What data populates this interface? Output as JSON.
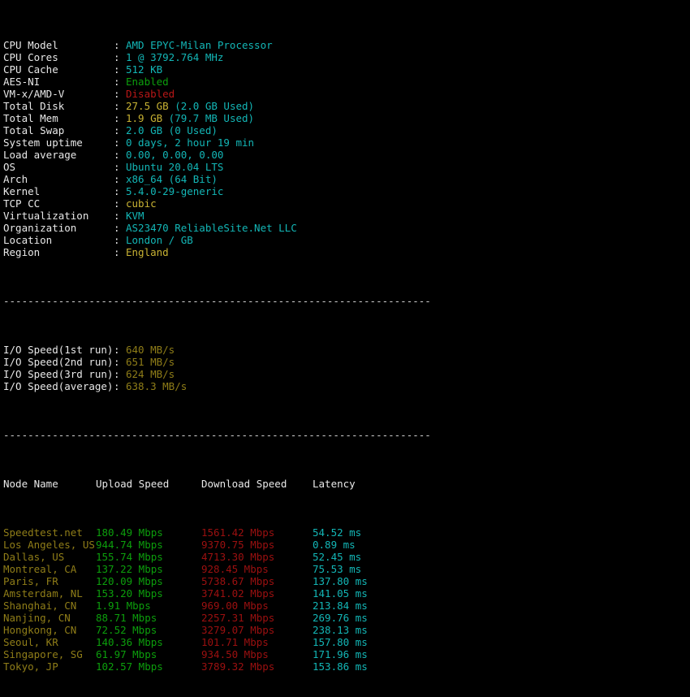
{
  "terminal": {
    "background": "#000000",
    "foreground": "#e8e8e8",
    "colors": {
      "cyan": "#13b6b6",
      "green": "#0c9e0c",
      "red": "#b81717",
      "dark_red": "#9c1010",
      "yellow": "#c8b233",
      "olive": "#8f7d18",
      "white": "#e8e8e8"
    }
  },
  "separator": "----------------------------------------------------------------------",
  "system_info": [
    {
      "label": "CPU Model",
      "colon": ":",
      "value": "AMD EPYC-Milan Processor",
      "value2": ""
    },
    {
      "label": "CPU Cores",
      "colon": ":",
      "value": "1 @ 3792.764 MHz",
      "value2": ""
    },
    {
      "label": "CPU Cache",
      "colon": ":",
      "value": "512 KB",
      "value2": ""
    },
    {
      "label": "AES-NI",
      "colon": ":",
      "value": "Enabled",
      "value2": ""
    },
    {
      "label": "VM-x/AMD-V",
      "colon": ":",
      "value": "Disabled",
      "value2": ""
    },
    {
      "label": "Total Disk",
      "colon": ":",
      "value": "27.5 GB",
      "value2": " (2.0 GB Used)"
    },
    {
      "label": "Total Mem",
      "colon": ":",
      "value": "1.9 GB",
      "value2": " (79.7 MB Used)"
    },
    {
      "label": "Total Swap",
      "colon": ":",
      "value": "2.0 GB (0 Used)",
      "value2": ""
    },
    {
      "label": "System uptime",
      "colon": ":",
      "value": "0 days, 2 hour 19 min",
      "value2": ""
    },
    {
      "label": "Load average",
      "colon": ":",
      "value": "0.00, 0.00, 0.00",
      "value2": ""
    },
    {
      "label": "OS",
      "colon": ":",
      "value": "Ubuntu 20.04 LTS",
      "value2": ""
    },
    {
      "label": "Arch",
      "colon": ":",
      "value": "x86_64 (64 Bit)",
      "value2": ""
    },
    {
      "label": "Kernel",
      "colon": ":",
      "value": "5.4.0-29-generic",
      "value2": ""
    },
    {
      "label": "TCP CC",
      "colon": ":",
      "value": "cubic",
      "value2": ""
    },
    {
      "label": "Virtualization",
      "colon": ":",
      "value": "KVM",
      "value2": ""
    },
    {
      "label": "Organization",
      "colon": ":",
      "value": "AS23470 ReliableSite.Net LLC",
      "value2": ""
    },
    {
      "label": "Location",
      "colon": ":",
      "value": "London / GB",
      "value2": ""
    },
    {
      "label": "Region",
      "colon": ":",
      "value": "England",
      "value2": ""
    }
  ],
  "io_speed": [
    {
      "label": "I/O Speed(1st run)",
      "colon": ":",
      "value": "640 MB/s"
    },
    {
      "label": "I/O Speed(2nd run)",
      "colon": ":",
      "value": "651 MB/s"
    },
    {
      "label": "I/O Speed(3rd run)",
      "colon": ":",
      "value": "624 MB/s"
    },
    {
      "label": "I/O Speed(average)",
      "colon": ":",
      "value": "638.3 MB/s"
    }
  ],
  "speedtest": {
    "headers": {
      "node": "Node Name",
      "upload": "Upload Speed",
      "download": "Download Speed",
      "latency": "Latency"
    },
    "rows": [
      {
        "node": "Speedtest.net",
        "upload": "180.49 Mbps",
        "download": "1561.42 Mbps",
        "latency": "54.52 ms"
      },
      {
        "node": "Los Angeles, US",
        "upload": "944.74 Mbps",
        "download": "9370.75 Mbps",
        "latency": "0.89 ms"
      },
      {
        "node": "Dallas, US",
        "upload": "155.74 Mbps",
        "download": "4713.30 Mbps",
        "latency": "52.45 ms"
      },
      {
        "node": "Montreal, CA",
        "upload": "137.22 Mbps",
        "download": "928.45 Mbps",
        "latency": "75.53 ms"
      },
      {
        "node": "Paris, FR",
        "upload": "120.09 Mbps",
        "download": "5738.67 Mbps",
        "latency": "137.80 ms"
      },
      {
        "node": "Amsterdam, NL",
        "upload": "153.20 Mbps",
        "download": "3741.02 Mbps",
        "latency": "141.05 ms"
      },
      {
        "node": "Shanghai, CN",
        "upload": "1.91 Mbps",
        "download": "969.00 Mbps",
        "latency": "213.84 ms"
      },
      {
        "node": "Nanjing, CN",
        "upload": "88.71 Mbps",
        "download": "2257.31 Mbps",
        "latency": "269.76 ms"
      },
      {
        "node": "Hongkong, CN",
        "upload": "72.52 Mbps",
        "download": "3279.07 Mbps",
        "latency": "238.13 ms"
      },
      {
        "node": "Seoul, KR",
        "upload": "140.36 Mbps",
        "download": "101.71 Mbps",
        "latency": "157.80 ms"
      },
      {
        "node": "Singapore, SG",
        "upload": "61.97 Mbps",
        "download": "934.50 Mbps",
        "latency": "171.96 ms"
      },
      {
        "node": "Tokyo, JP",
        "upload": "102.57 Mbps",
        "download": "3789.32 Mbps",
        "latency": "153.86 ms"
      }
    ]
  }
}
